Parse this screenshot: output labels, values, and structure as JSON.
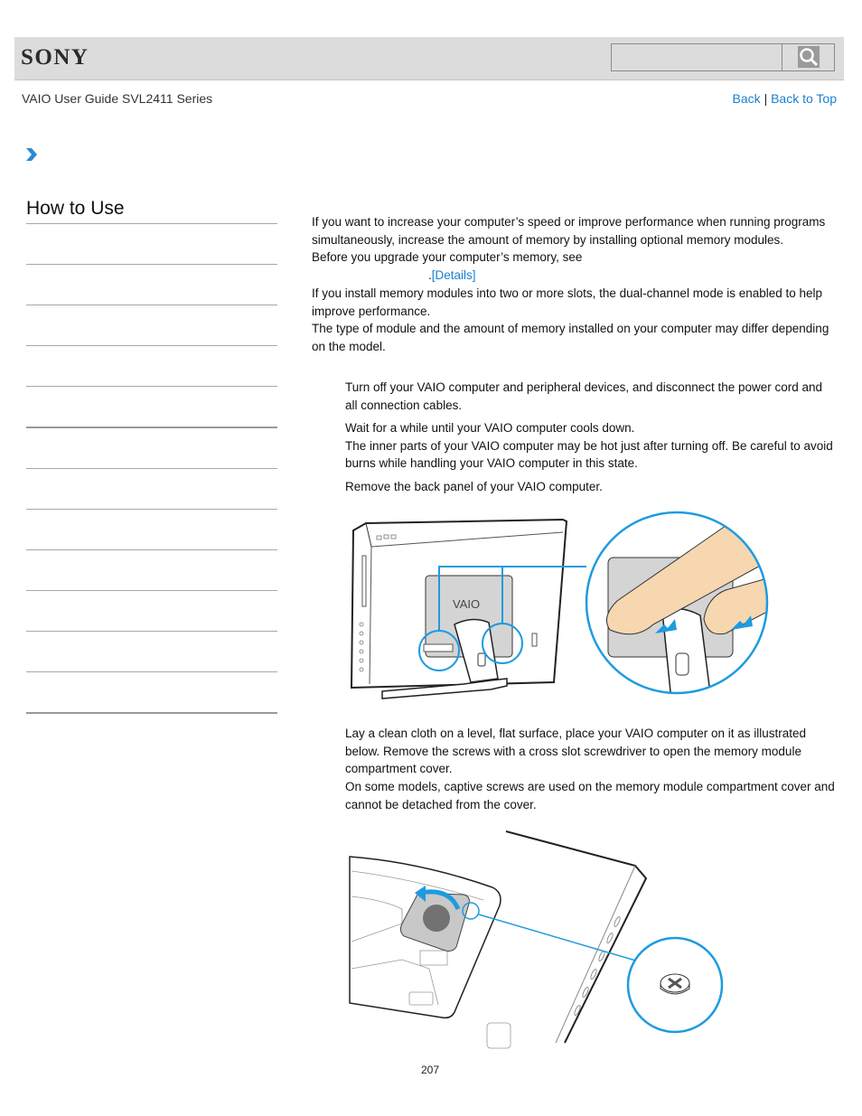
{
  "header": {
    "brand": "SONY",
    "search": {
      "placeholder": "",
      "value": ""
    },
    "search_icon": "magnifier-icon"
  },
  "subheader": {
    "guide_title": "VAIO User Guide SVL2411 Series",
    "back_label": "Back",
    "separator": "|",
    "back_to_top_label": "Back to Top"
  },
  "breadcrumb": {
    "icon": "chevron-right-icon"
  },
  "sidebar": {
    "title": "How to Use",
    "items": [
      "",
      "",
      "",
      "",
      "",
      "",
      "",
      "",
      "",
      "",
      "",
      ""
    ]
  },
  "main": {
    "intro": [
      "If you want to increase your computer’s speed or improve performance when running programs simultaneously, increase the amount of memory by installing optional memory modules.",
      "Before you upgrade your computer’s memory, see"
    ],
    "details_prefix": ".",
    "details_link": "[Details]",
    "notes": [
      "If you install memory modules into two or more slots, the dual-channel mode is enabled to help improve performance.",
      "The type of module and the amount of memory installed on your computer may differ depending on the model."
    ],
    "steps": [
      {
        "lines": [
          "Turn off your VAIO computer and peripheral devices, and disconnect the power cord and all connection cables."
        ]
      },
      {
        "lines": [
          "Wait for a while until your VAIO computer cools down.",
          "The inner parts of your VAIO computer may be hot just after turning off. Be careful to avoid burns while handling your VAIO computer in this state."
        ]
      },
      {
        "lines": [
          "Remove the back panel of your VAIO computer."
        ]
      },
      {
        "lines": [
          "Lay a clean cloth on a level, flat surface, place your VAIO computer on it as illustrated below. Remove the screws with a cross slot screwdriver to open the memory module compartment cover.",
          "On some models, captive screws are used on the memory module compartment cover and cannot be detached from the cover."
        ]
      }
    ],
    "illustration1": {
      "logo_text": "VAIO",
      "description": "Removing back panel of VAIO computer"
    },
    "illustration2": {
      "description": "Opening memory module compartment cover with screw detail"
    }
  },
  "footer": {
    "page_number": "207"
  },
  "colors": {
    "accent": "#1a7fd0",
    "callout": "#1e9be0",
    "header_bg": "#dcdcdc",
    "skin": "#f6d7b0"
  }
}
